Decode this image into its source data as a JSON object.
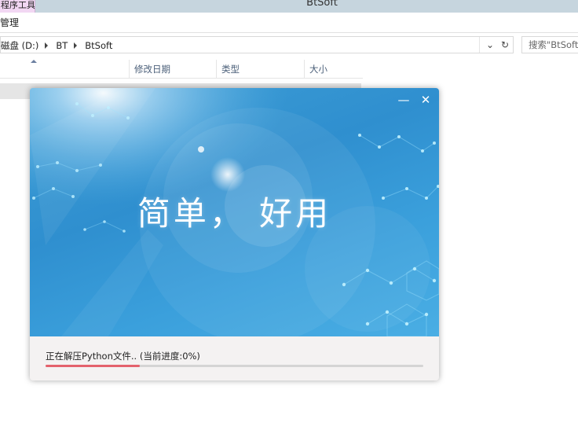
{
  "explorer": {
    "ribbon_tab": "程序工具",
    "window_title": "BtSoft",
    "ribbon_item": "管理",
    "breadcrumbs": [
      "磁盘 (D:)",
      "BT",
      "BtSoft"
    ],
    "search_placeholder": "搜索\"BtSoft\"",
    "columns": [
      "修改日期",
      "类型",
      "大小"
    ]
  },
  "installer": {
    "slogan": "简单， 好用",
    "status": "正在解压Python文件.. (当前进度:0%)",
    "progress": 0.25,
    "buttons": {
      "minimize": "—",
      "close": "✕"
    }
  },
  "colors": {
    "banner": "#3a9cd8",
    "progress": "#e4626d",
    "track": "#d4d4d4"
  }
}
